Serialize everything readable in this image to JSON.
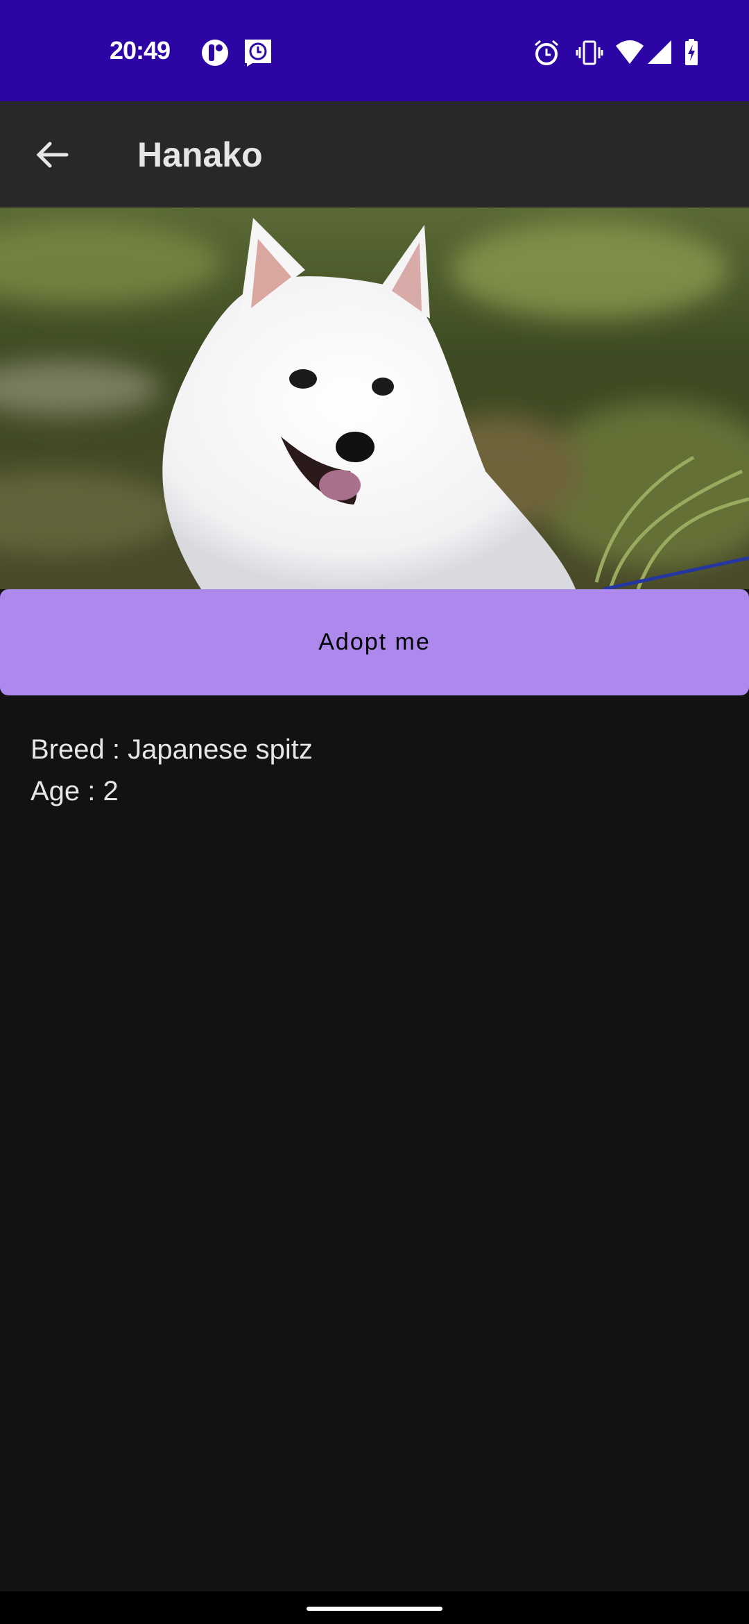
{
  "status_bar": {
    "time": "20:49",
    "left_icons": [
      "notification-app-icon",
      "message-sync-icon"
    ],
    "right_icons": [
      "alarm-icon",
      "vibrate-icon",
      "wifi-icon",
      "signal-icon",
      "battery-charging-icon"
    ],
    "color": "#2d05a4"
  },
  "app_bar": {
    "title": "Hanako",
    "back_icon": "arrow-back-icon"
  },
  "photo": {
    "subject": "dog-photo"
  },
  "adopt_button": {
    "label": "Adopt me",
    "color": "#ad89ee"
  },
  "details": {
    "breed": "Breed : Japanese spitz",
    "age": "Age : 2"
  }
}
